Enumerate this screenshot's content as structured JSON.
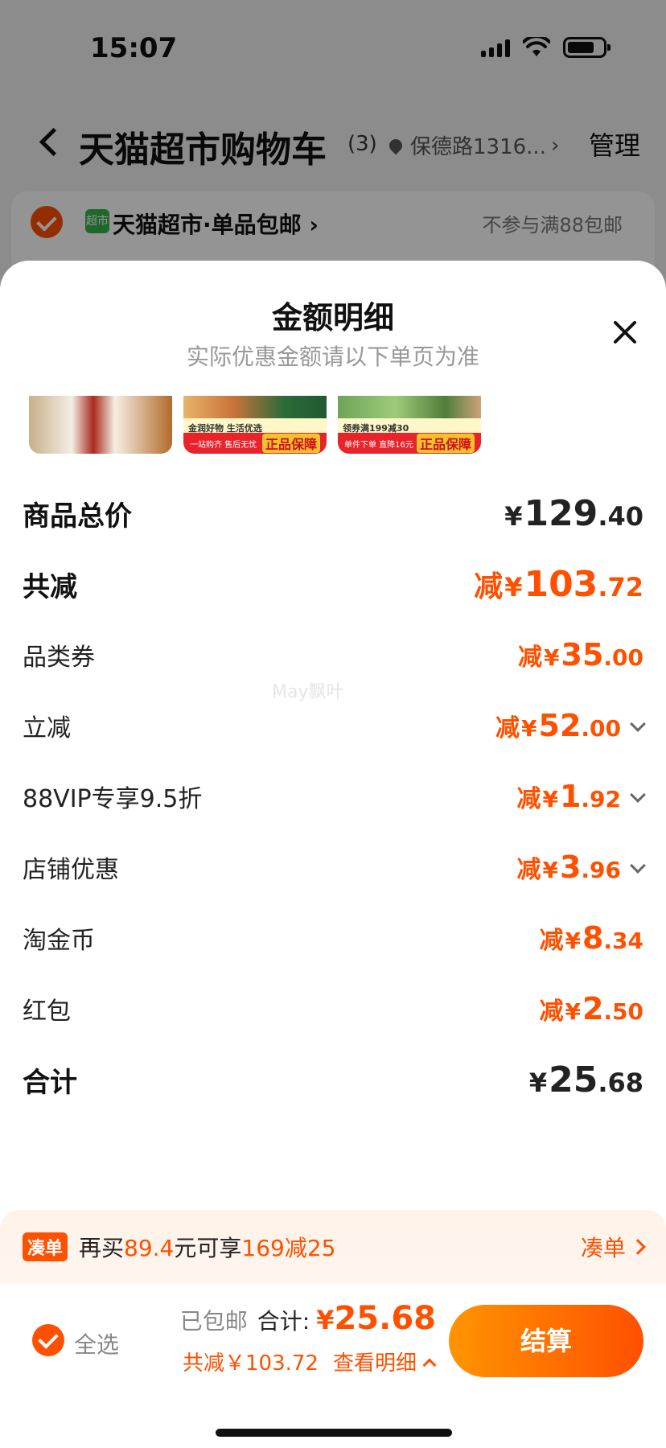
{
  "status_bar": {
    "time": "15:07"
  },
  "nav": {
    "title": "天猫超市购物车",
    "count": "(3)",
    "location": "保德路1316...",
    "manage": "管理"
  },
  "store": {
    "logo": "超市",
    "name": "天猫超市·单品包邮 ›",
    "note": "不参与满88包邮"
  },
  "sheet": {
    "title": "金额明细",
    "subtitle": "实际优惠金额请以下单页为准",
    "watermark": "May飘叶",
    "thumbnails": [
      {
        "name": "product-thumb-1"
      },
      {
        "name": "product-thumb-2",
        "promo": "金润好物 生活优选",
        "small": "一站购齐 售后无忧",
        "badge": "正品保障"
      },
      {
        "name": "product-thumb-3",
        "promo": "领券满199减30",
        "small": "单件下单 直降16元",
        "badge": "正品保障"
      }
    ],
    "rows": [
      {
        "label": "商品总价",
        "prefix": "",
        "yen": "¥",
        "int": "129",
        "dec": ".40",
        "strong": true,
        "orange": false,
        "chevron": false
      },
      {
        "label": "共减",
        "prefix": "减",
        "yen": "¥",
        "int": "103",
        "dec": ".72",
        "strong": true,
        "orange": true,
        "chevron": false
      },
      {
        "label": "品类券",
        "prefix": "减",
        "yen": "¥",
        "int": "35",
        "dec": ".00",
        "strong": false,
        "orange": true,
        "chevron": false
      },
      {
        "label": "立减",
        "prefix": "减",
        "yen": "¥",
        "int": "52",
        "dec": ".00",
        "strong": false,
        "orange": true,
        "chevron": true
      },
      {
        "label": "88VIP专享9.5折",
        "prefix": "减",
        "yen": "¥",
        "int": "1",
        "dec": ".92",
        "strong": false,
        "orange": true,
        "chevron": true
      },
      {
        "label": "店铺优惠",
        "prefix": "减",
        "yen": "¥",
        "int": "3",
        "dec": ".96",
        "strong": false,
        "orange": true,
        "chevron": true
      },
      {
        "label": "淘金币",
        "prefix": "减",
        "yen": "¥",
        "int": "8",
        "dec": ".34",
        "strong": false,
        "orange": true,
        "chevron": false
      },
      {
        "label": "红包",
        "prefix": "减",
        "yen": "¥",
        "int": "2",
        "dec": ".50",
        "strong": false,
        "orange": true,
        "chevron": false
      },
      {
        "label": "合计",
        "prefix": "",
        "yen": "¥",
        "int": "25",
        "dec": ".68",
        "strong": true,
        "orange": false,
        "chevron": false
      }
    ]
  },
  "promo": {
    "tag": "凑单",
    "text_before": "再买",
    "amount": "89.4",
    "text_mid": "元可享",
    "offer": "169减25",
    "link": "凑单"
  },
  "checkout": {
    "select_all": "全选",
    "shipped": "已包邮",
    "total_label": "合计:",
    "total_yen": "¥",
    "total_value": "25.68",
    "saved": "共减￥103.72",
    "detail_link": "查看明细",
    "pay_button": "结算"
  },
  "colors": {
    "accent": "#ff5000",
    "accent_light": "#ff9500"
  }
}
